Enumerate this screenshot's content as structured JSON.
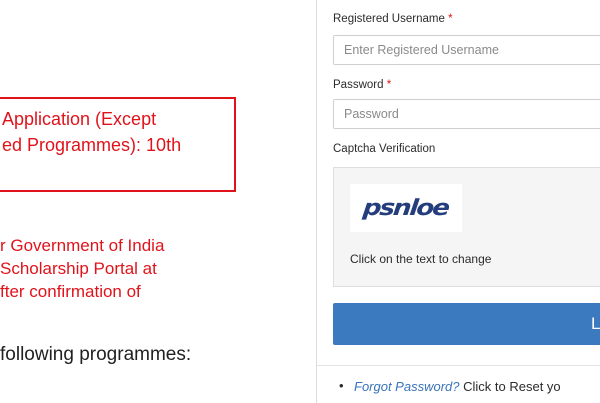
{
  "notice": {
    "line1": "Application (Except",
    "line2": "ed Programmes): 10th"
  },
  "info_para": {
    "line1": "r Government of India",
    "line2": " Scholarship Portal at",
    "line3": "fter confirmation of"
  },
  "programmes_line": " following programmes:",
  "login": {
    "username_label": "Registered Username",
    "username_placeholder": "Enter Registered Username",
    "password_label": "Password",
    "password_placeholder": "Password",
    "required_marker": "*",
    "captcha_label": "Captcha Verification",
    "captcha_text": "psnloe",
    "captcha_hint": "Click on the text to change",
    "button_label": "L",
    "forgot_link": "Forgot Password?",
    "forgot_text": " Click to Reset yo"
  },
  "colors": {
    "notice_red": "#e0131b",
    "button_blue": "#3b7abf",
    "link_blue": "#3a74b8"
  }
}
